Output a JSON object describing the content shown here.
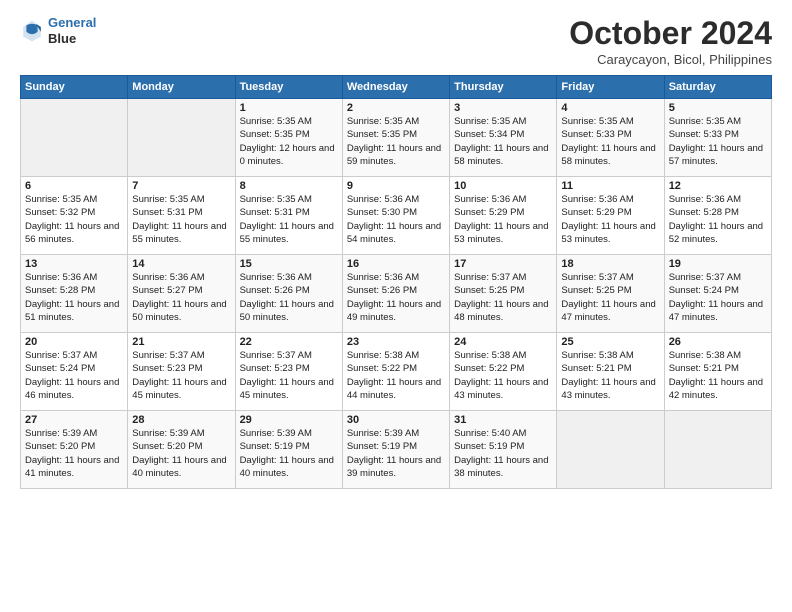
{
  "logo": {
    "line1": "General",
    "line2": "Blue"
  },
  "title": "October 2024",
  "subtitle": "Caraycayon, Bicol, Philippines",
  "header_days": [
    "Sunday",
    "Monday",
    "Tuesday",
    "Wednesday",
    "Thursday",
    "Friday",
    "Saturday"
  ],
  "weeks": [
    [
      {
        "day": "",
        "info": ""
      },
      {
        "day": "",
        "info": ""
      },
      {
        "day": "1",
        "sunrise": "Sunrise: 5:35 AM",
        "sunset": "Sunset: 5:35 PM",
        "daylight": "Daylight: 12 hours and 0 minutes."
      },
      {
        "day": "2",
        "sunrise": "Sunrise: 5:35 AM",
        "sunset": "Sunset: 5:35 PM",
        "daylight": "Daylight: 11 hours and 59 minutes."
      },
      {
        "day": "3",
        "sunrise": "Sunrise: 5:35 AM",
        "sunset": "Sunset: 5:34 PM",
        "daylight": "Daylight: 11 hours and 58 minutes."
      },
      {
        "day": "4",
        "sunrise": "Sunrise: 5:35 AM",
        "sunset": "Sunset: 5:33 PM",
        "daylight": "Daylight: 11 hours and 58 minutes."
      },
      {
        "day": "5",
        "sunrise": "Sunrise: 5:35 AM",
        "sunset": "Sunset: 5:33 PM",
        "daylight": "Daylight: 11 hours and 57 minutes."
      }
    ],
    [
      {
        "day": "6",
        "sunrise": "Sunrise: 5:35 AM",
        "sunset": "Sunset: 5:32 PM",
        "daylight": "Daylight: 11 hours and 56 minutes."
      },
      {
        "day": "7",
        "sunrise": "Sunrise: 5:35 AM",
        "sunset": "Sunset: 5:31 PM",
        "daylight": "Daylight: 11 hours and 55 minutes."
      },
      {
        "day": "8",
        "sunrise": "Sunrise: 5:35 AM",
        "sunset": "Sunset: 5:31 PM",
        "daylight": "Daylight: 11 hours and 55 minutes."
      },
      {
        "day": "9",
        "sunrise": "Sunrise: 5:36 AM",
        "sunset": "Sunset: 5:30 PM",
        "daylight": "Daylight: 11 hours and 54 minutes."
      },
      {
        "day": "10",
        "sunrise": "Sunrise: 5:36 AM",
        "sunset": "Sunset: 5:29 PM",
        "daylight": "Daylight: 11 hours and 53 minutes."
      },
      {
        "day": "11",
        "sunrise": "Sunrise: 5:36 AM",
        "sunset": "Sunset: 5:29 PM",
        "daylight": "Daylight: 11 hours and 53 minutes."
      },
      {
        "day": "12",
        "sunrise": "Sunrise: 5:36 AM",
        "sunset": "Sunset: 5:28 PM",
        "daylight": "Daylight: 11 hours and 52 minutes."
      }
    ],
    [
      {
        "day": "13",
        "sunrise": "Sunrise: 5:36 AM",
        "sunset": "Sunset: 5:28 PM",
        "daylight": "Daylight: 11 hours and 51 minutes."
      },
      {
        "day": "14",
        "sunrise": "Sunrise: 5:36 AM",
        "sunset": "Sunset: 5:27 PM",
        "daylight": "Daylight: 11 hours and 50 minutes."
      },
      {
        "day": "15",
        "sunrise": "Sunrise: 5:36 AM",
        "sunset": "Sunset: 5:26 PM",
        "daylight": "Daylight: 11 hours and 50 minutes."
      },
      {
        "day": "16",
        "sunrise": "Sunrise: 5:36 AM",
        "sunset": "Sunset: 5:26 PM",
        "daylight": "Daylight: 11 hours and 49 minutes."
      },
      {
        "day": "17",
        "sunrise": "Sunrise: 5:37 AM",
        "sunset": "Sunset: 5:25 PM",
        "daylight": "Daylight: 11 hours and 48 minutes."
      },
      {
        "day": "18",
        "sunrise": "Sunrise: 5:37 AM",
        "sunset": "Sunset: 5:25 PM",
        "daylight": "Daylight: 11 hours and 47 minutes."
      },
      {
        "day": "19",
        "sunrise": "Sunrise: 5:37 AM",
        "sunset": "Sunset: 5:24 PM",
        "daylight": "Daylight: 11 hours and 47 minutes."
      }
    ],
    [
      {
        "day": "20",
        "sunrise": "Sunrise: 5:37 AM",
        "sunset": "Sunset: 5:24 PM",
        "daylight": "Daylight: 11 hours and 46 minutes."
      },
      {
        "day": "21",
        "sunrise": "Sunrise: 5:37 AM",
        "sunset": "Sunset: 5:23 PM",
        "daylight": "Daylight: 11 hours and 45 minutes."
      },
      {
        "day": "22",
        "sunrise": "Sunrise: 5:37 AM",
        "sunset": "Sunset: 5:23 PM",
        "daylight": "Daylight: 11 hours and 45 minutes."
      },
      {
        "day": "23",
        "sunrise": "Sunrise: 5:38 AM",
        "sunset": "Sunset: 5:22 PM",
        "daylight": "Daylight: 11 hours and 44 minutes."
      },
      {
        "day": "24",
        "sunrise": "Sunrise: 5:38 AM",
        "sunset": "Sunset: 5:22 PM",
        "daylight": "Daylight: 11 hours and 43 minutes."
      },
      {
        "day": "25",
        "sunrise": "Sunrise: 5:38 AM",
        "sunset": "Sunset: 5:21 PM",
        "daylight": "Daylight: 11 hours and 43 minutes."
      },
      {
        "day": "26",
        "sunrise": "Sunrise: 5:38 AM",
        "sunset": "Sunset: 5:21 PM",
        "daylight": "Daylight: 11 hours and 42 minutes."
      }
    ],
    [
      {
        "day": "27",
        "sunrise": "Sunrise: 5:39 AM",
        "sunset": "Sunset: 5:20 PM",
        "daylight": "Daylight: 11 hours and 41 minutes."
      },
      {
        "day": "28",
        "sunrise": "Sunrise: 5:39 AM",
        "sunset": "Sunset: 5:20 PM",
        "daylight": "Daylight: 11 hours and 40 minutes."
      },
      {
        "day": "29",
        "sunrise": "Sunrise: 5:39 AM",
        "sunset": "Sunset: 5:19 PM",
        "daylight": "Daylight: 11 hours and 40 minutes."
      },
      {
        "day": "30",
        "sunrise": "Sunrise: 5:39 AM",
        "sunset": "Sunset: 5:19 PM",
        "daylight": "Daylight: 11 hours and 39 minutes."
      },
      {
        "day": "31",
        "sunrise": "Sunrise: 5:40 AM",
        "sunset": "Sunset: 5:19 PM",
        "daylight": "Daylight: 11 hours and 38 minutes."
      },
      {
        "day": "",
        "info": ""
      },
      {
        "day": "",
        "info": ""
      }
    ]
  ]
}
